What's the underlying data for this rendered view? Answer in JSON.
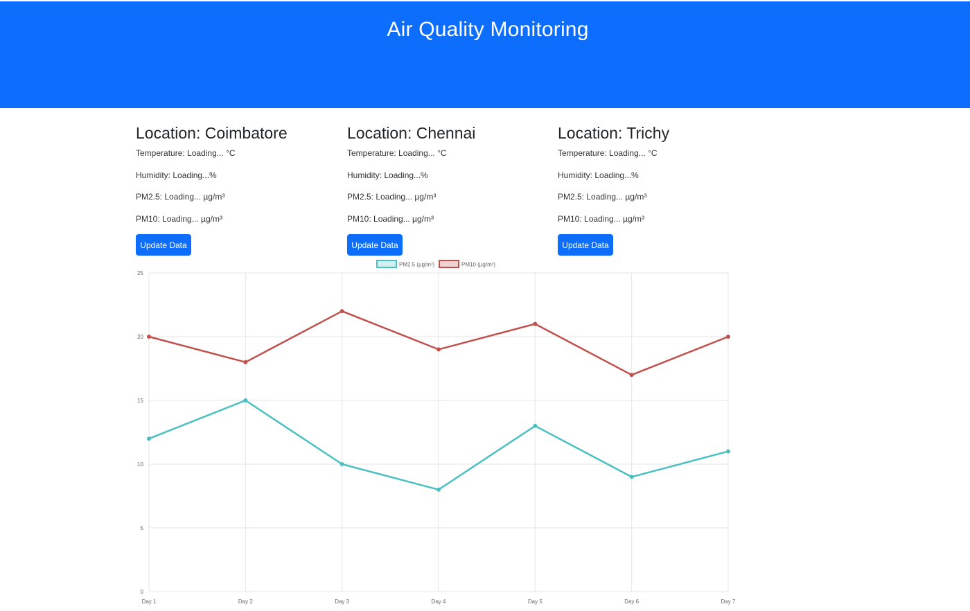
{
  "header": {
    "title": "Air Quality Monitoring"
  },
  "accent": "#0d6efd",
  "locations": [
    {
      "title": "Location: Coimbatore",
      "temperature": "Temperature: Loading... °C",
      "humidity": "Humidity: Loading...%",
      "pm25": "PM2.5: Loading... µg/m³",
      "pm10": "PM10: Loading... µg/m³",
      "button": "Update Data"
    },
    {
      "title": "Location: Chennai",
      "temperature": "Temperature: Loading... °C",
      "humidity": "Humidity: Loading...%",
      "pm25": "PM2.5: Loading... µg/m³",
      "pm10": "PM10: Loading... µg/m³",
      "button": "Update Data"
    },
    {
      "title": "Location: Trichy",
      "temperature": "Temperature: Loading... °C",
      "humidity": "Humidity: Loading...%",
      "pm25": "PM2.5: Loading... µg/m³",
      "pm10": "PM10: Loading... µg/m³",
      "button": "Update Data"
    }
  ],
  "chart_data": {
    "type": "line",
    "categories": [
      "Day 1",
      "Day 2",
      "Day 3",
      "Day 4",
      "Day 5",
      "Day 6",
      "Day 7"
    ],
    "series": [
      {
        "name": "PM2.5 (µg/m³)",
        "values": [
          12,
          15,
          10,
          8,
          13,
          9,
          11
        ],
        "color": "#4bc0c0"
      },
      {
        "name": "PM10 (µg/m³)",
        "values": [
          20,
          18,
          22,
          19,
          21,
          17,
          20
        ],
        "color": "#c0504d"
      }
    ],
    "ylim": [
      0,
      25
    ],
    "yticks": [
      "0",
      "5",
      "10",
      "15",
      "20",
      "25"
    ],
    "grid": true,
    "legend": "top-center"
  }
}
